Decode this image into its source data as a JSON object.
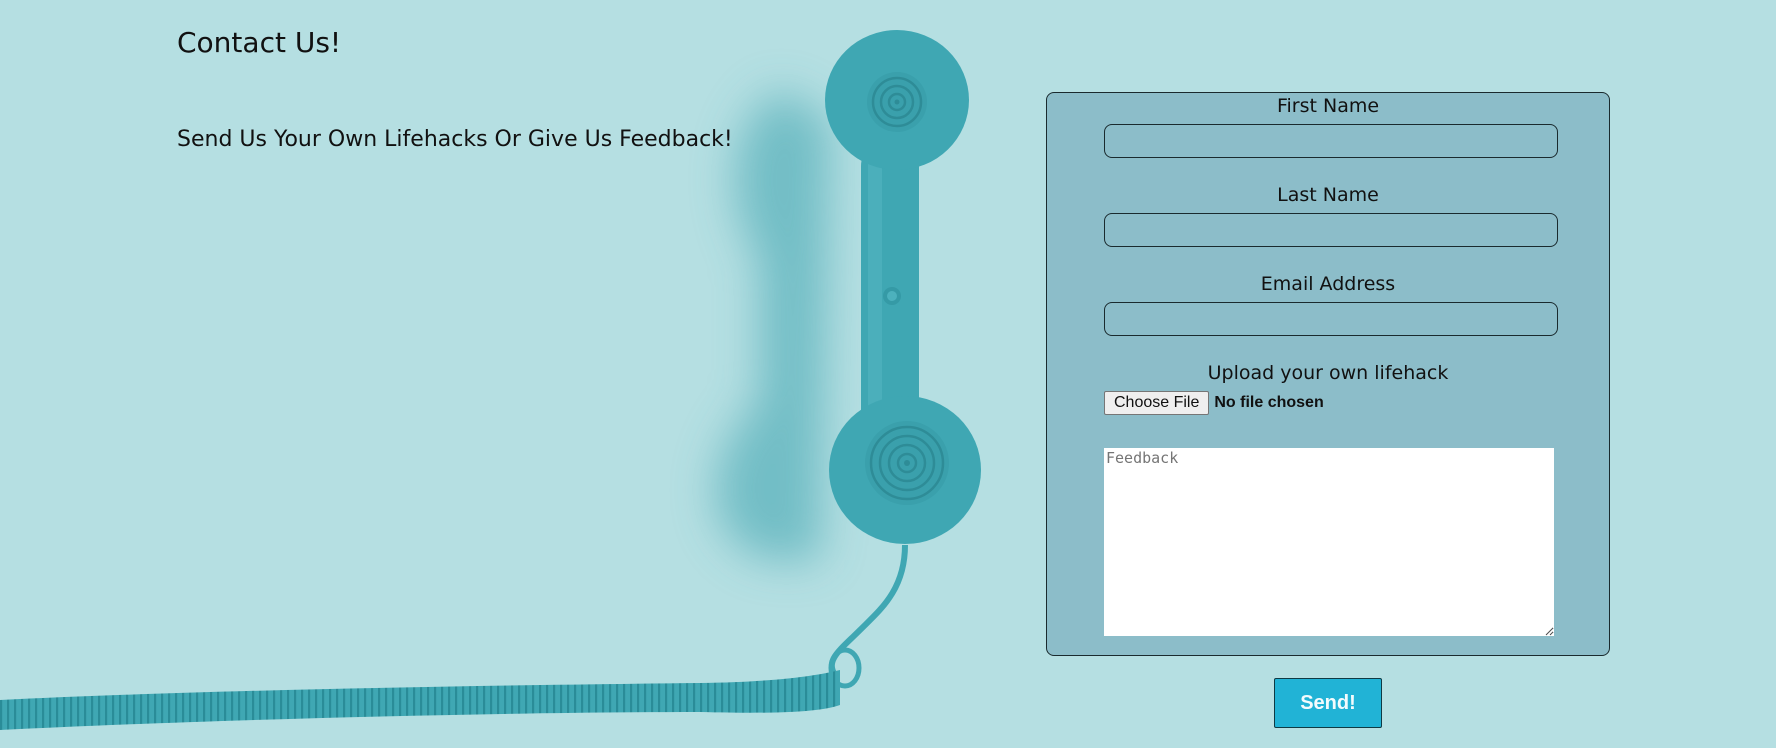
{
  "page": {
    "title": "Contact Us!",
    "subtitle": "Send Us Your Own Lifehacks Or Give Us Feedback!"
  },
  "form": {
    "first_name_label": "First Name",
    "last_name_label": "Last Name",
    "email_label": "Email Address",
    "upload_label": "Upload your own lifehack",
    "file_button_label": "Choose File",
    "file_status": "No file chosen",
    "feedback_placeholder": "Feedback",
    "send_label": "Send!"
  },
  "colors": {
    "background": "#b5dfe2",
    "form_panel": "#8cbdc9",
    "phone": "#3fa7b3",
    "send_button": "#21b3d6"
  },
  "icons": {
    "background_image": "telephone-handset"
  }
}
